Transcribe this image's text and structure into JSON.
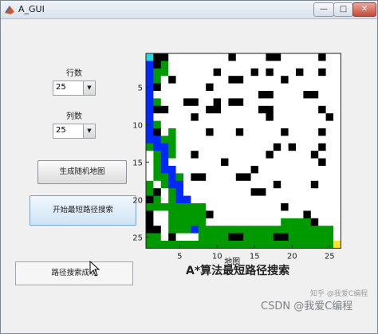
{
  "window": {
    "title": "A_GUI",
    "min_glyph": "—",
    "max_glyph": "□",
    "close_glyph": "✕"
  },
  "controls": {
    "rows_label": "行数",
    "rows_value": "25",
    "cols_label": "列数",
    "cols_value": "25",
    "gen_map_button": "生成随机地图",
    "start_search_button": "开始最短路径搜索",
    "status_text": "路径搜索成功"
  },
  "chart_data": {
    "type": "heatmap",
    "title": "A*算法最短路径搜索",
    "xlabel": "地图",
    "rows": 26,
    "cols": 26,
    "x_ticks": [
      5,
      10,
      15,
      20,
      25
    ],
    "y_ticks": [
      5,
      10,
      15,
      20,
      25
    ],
    "colors": {
      "free": "#ffffff",
      "obstacle": "#000000",
      "explored": "#009a00",
      "path": "#0028ff",
      "start": "#27d7dc",
      "goal": "#ffe22c"
    },
    "legend_codes": {
      "0": "free",
      "1": "obstacle",
      "2": "explored",
      "3": "path",
      "4": "start",
      "5": "goal"
    },
    "grid": [
      "41100000000100001100000100",
      "31200000000000000000000000",
      "32200000010000101000100100",
      "32010000000110000010000000",
      "31000000100000000000000000",
      "30000000000000011000011000",
      "32000110010110000000000000",
      "31100000110000011000000100",
      "30000010000000001000000010",
      "32000000000000000000000000",
      "31020000100010000010000100",
      "33220000000000000000000000",
      "23320000000000000101000100",
      "02320010000000001000001000",
      "02300000001000000000000100",
      "02330000000000100000000000",
      "02232011000011000000000000",
      "20233000000000000100001000",
      "21023000000000110000000000",
      "12023300000000000000000000",
      "22222222000000000010000000",
      "10022222100000000000010000",
      "10022222000000000022221000",
      "11022232222222222222222220",
      "22010002222112222112222220",
      "22222222222222222222222225"
    ]
  },
  "watermark": {
    "line1": "知乎 @我爱C编程",
    "line2": "CSDN @我爱C编程"
  }
}
